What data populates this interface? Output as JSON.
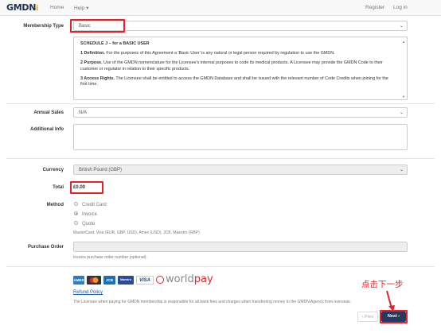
{
  "navbar": {
    "logo_text": "GMDN",
    "logo_suffix": "i",
    "home": "Home",
    "help": "Help ▾",
    "register": "Register",
    "login": "Log in"
  },
  "membership": {
    "label": "Membership Type",
    "value": "Basic"
  },
  "agreement": {
    "title": "SCHEDULE J – for a BASIC USER",
    "p1_bold": "1 Definition.",
    "p1": " For the purposes of this Agreement a 'Basic User' is any natural or legal person required by regulation to use the GMDN.",
    "p2_bold": "2 Purpose.",
    "p2": " Use of the GMDN nomenclature for the Licensee's internal purposes to code its medical products. A Licensee may provide the GMDN Code to their customer or regulator in relation to their specific products.",
    "p3_bold": "3 Access Rights.",
    "p3": " The Licensee shall be entitled to access the GMDN Database and shall be issued with the relevant number of Code Credits when joining for the first time."
  },
  "annual_sales": {
    "label": "Annual Sales",
    "value": "N/A"
  },
  "additional_info": {
    "label": "Additional Info",
    "value": ""
  },
  "currency": {
    "label": "Currency",
    "value": "British Pound (GBP)"
  },
  "total": {
    "label": "Total",
    "value": "£0.00"
  },
  "method": {
    "label": "Method",
    "options": [
      "Credit Card",
      "Invoice",
      "Quote"
    ],
    "selected": "Invoice",
    "cards_note": "MasterCard, Visa (EUR, GBP, USD), Amex (USD), JCB, Maestro (GBP)"
  },
  "purchase_order": {
    "label": "Purchase Order",
    "value": "",
    "help": "Invoice purchase order number (optional)."
  },
  "payment_logos": {
    "amex": "AMEX",
    "mastercard": "MC",
    "jcb": "JCB",
    "maestro": "Maestro",
    "visa": "VISA",
    "worldpay_a": "world",
    "worldpay_b": "pay"
  },
  "refund_policy": "Refund Policy",
  "footer_note": "The Licensee when paying for GMDN membership is responsible for all bank fees and charges when transferring money to the GMDN Agency from overseas.",
  "buttons": {
    "prev": "‹ Prev",
    "next": "Next ›"
  },
  "annotation": "点击下一步",
  "colors": {
    "highlight": "#e0242a",
    "primary": "#263a5f",
    "link": "#1a5aa0"
  }
}
